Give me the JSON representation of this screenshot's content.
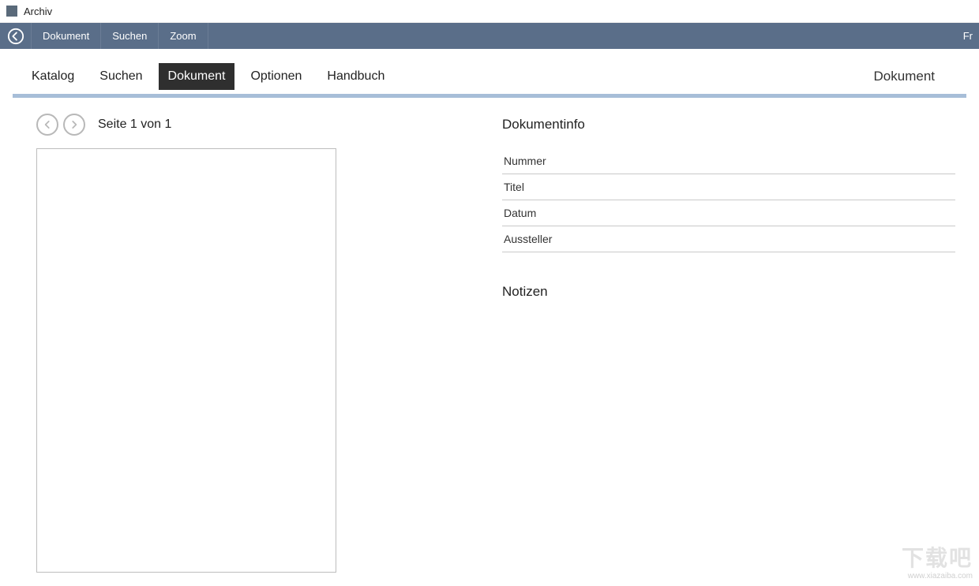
{
  "window": {
    "title": "Archiv"
  },
  "menubar": {
    "items": [
      "Dokument",
      "Suchen",
      "Zoom"
    ],
    "right_truncated": "Fr"
  },
  "tabs": {
    "items": [
      "Katalog",
      "Suchen",
      "Dokument",
      "Optionen",
      "Handbuch"
    ],
    "active_index": 2,
    "context_label": "Dokument"
  },
  "pager": {
    "label": "Seite 1 von 1"
  },
  "info": {
    "title": "Dokumentinfo",
    "fields": [
      "Nummer",
      "Titel",
      "Datum",
      "Aussteller"
    ]
  },
  "notes": {
    "title": "Notizen"
  },
  "watermark": {
    "big": "下载吧",
    "url": "www.xiazaiba.com"
  }
}
